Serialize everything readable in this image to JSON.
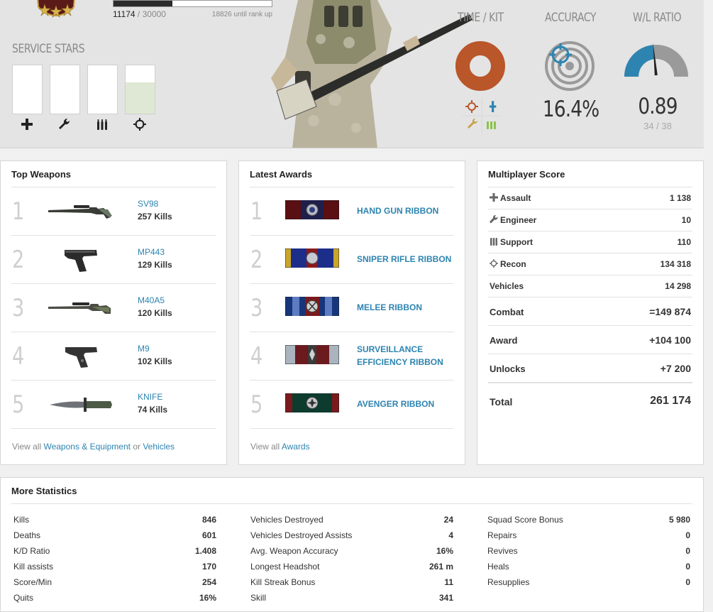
{
  "hero": {
    "rank": {
      "xp_current": "11174",
      "xp_total": " / 30000",
      "until_rank_up": "18826 until rank up",
      "progress": 0.3725
    },
    "service_stars": {
      "title": "SERVICE STARS",
      "items": [
        {
          "icon": "plus-icon",
          "progress": 0
        },
        {
          "icon": "wrench-icon",
          "progress": 0
        },
        {
          "icon": "ammo-icon",
          "progress": 0
        },
        {
          "icon": "crosshair-icon",
          "progress": 0.65
        }
      ]
    },
    "time_kit": {
      "title": "TIME / KIT",
      "color": "#b9562a"
    },
    "accuracy": {
      "title": "ACCURACY",
      "value": "16.4%",
      "fraction": 0.164
    },
    "wl_ratio": {
      "title": "W/L RATIO",
      "value": "0.89",
      "count": "34 / 38",
      "fraction": 0.47
    }
  },
  "top_weapons": {
    "title": "Top Weapons",
    "items": [
      {
        "rank": "1",
        "name": "SV98",
        "kills": "257 Kills",
        "icon": "sniper-rifle-icon"
      },
      {
        "rank": "2",
        "name": "MP443",
        "kills": "129 Kills",
        "icon": "pistol-icon"
      },
      {
        "rank": "3",
        "name": "M40A5",
        "kills": "120 Kills",
        "icon": "sniper-rifle-icon"
      },
      {
        "rank": "4",
        "name": "M9",
        "kills": "102 Kills",
        "icon": "pistol-icon"
      },
      {
        "rank": "5",
        "name": "KNIFE",
        "kills": "74 Kills",
        "icon": "knife-icon"
      }
    ],
    "view_all_prefix": "View all ",
    "view_all_link1": "Weapons & Equipment",
    "view_all_or": " or ",
    "view_all_link2": "Vehicles"
  },
  "latest_awards": {
    "title": "Latest Awards",
    "items": [
      {
        "rank": "1",
        "name": "HAND GUN RIBBON",
        "line2": "",
        "colors": [
          "#5a0f12",
          "#1e1f4a"
        ]
      },
      {
        "rank": "2",
        "name": "SNIPER RIFLE RIBBON",
        "line2": "",
        "colors": [
          "#1c2d8a",
          "#c8a62a"
        ]
      },
      {
        "rank": "3",
        "name": "MELEE RIBBON",
        "line2": "",
        "colors": [
          "#17357a",
          "#5c7bc0"
        ]
      },
      {
        "rank": "4",
        "name": "SURVEILLANCE",
        "line2": "EFFICIENCY RIBBON",
        "colors": [
          "#6b1a1e",
          "#a9b4bf"
        ]
      },
      {
        "rank": "5",
        "name": "AVENGER RIBBON",
        "line2": "",
        "colors": [
          "#0d3b2e",
          "#7a1a1c"
        ]
      }
    ],
    "view_all_prefix": "View all ",
    "view_all_link": "Awards"
  },
  "multiplayer_score": {
    "title": "Multiplayer Score",
    "rows": [
      {
        "label": "Assault",
        "value": "1 138",
        "icon": "plus-icon"
      },
      {
        "label": "Engineer",
        "value": "10",
        "icon": "wrench-icon"
      },
      {
        "label": "Support",
        "value": "110",
        "icon": "ammo-icon"
      },
      {
        "label": "Recon",
        "value": "134 318",
        "icon": "crosshair-icon"
      },
      {
        "label": "Vehicles",
        "value": "14 298",
        "icon": ""
      }
    ],
    "combat": {
      "label": "Combat",
      "value": "=149 874"
    },
    "award": {
      "label": "Award",
      "value": "+104 100"
    },
    "unlocks": {
      "label": "Unlocks",
      "value": "+7 200"
    },
    "total": {
      "label": "Total",
      "value": "261 174"
    }
  },
  "more_statistics": {
    "title": "More Statistics",
    "col1": [
      {
        "label": "Kills",
        "value": "846"
      },
      {
        "label": "Deaths",
        "value": "601"
      },
      {
        "label": "K/D Ratio",
        "value": "1.408"
      },
      {
        "label": "Kill assists",
        "value": "170"
      },
      {
        "label": "Score/Min",
        "value": "254"
      },
      {
        "label": "Quits",
        "value": "16%"
      }
    ],
    "col2": [
      {
        "label": "Vehicles Destroyed",
        "value": "24"
      },
      {
        "label": "Vehicles Destroyed Assists",
        "value": "4"
      },
      {
        "label": "Avg. Weapon Accuracy",
        "value": "16%"
      },
      {
        "label": "Longest Headshot",
        "value": "261 m"
      },
      {
        "label": "Kill Streak Bonus",
        "value": "11"
      },
      {
        "label": "Skill",
        "value": "341"
      }
    ],
    "col3": [
      {
        "label": "Squad Score Bonus",
        "value": "5 980"
      },
      {
        "label": "Repairs",
        "value": "0"
      },
      {
        "label": "Revives",
        "value": "0"
      },
      {
        "label": "Heals",
        "value": "0"
      },
      {
        "label": "Resupplies",
        "value": "0"
      }
    ]
  }
}
